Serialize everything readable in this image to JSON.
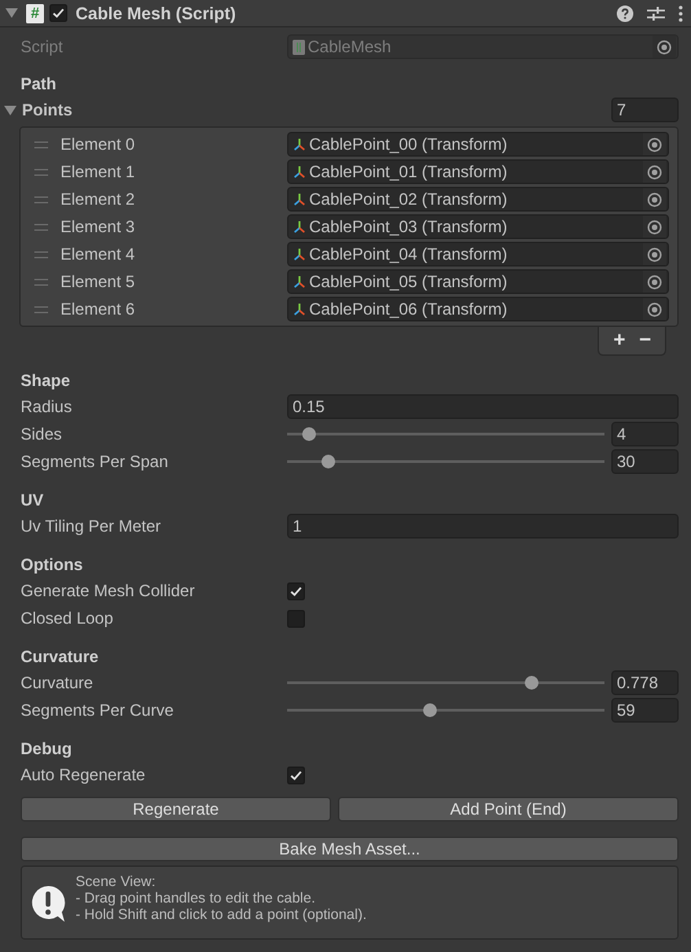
{
  "component": {
    "title": "Cable Mesh (Script)",
    "icon": "#",
    "enabled": true,
    "expanded": true
  },
  "script_field": {
    "label": "Script",
    "value": "CableMesh"
  },
  "sections": [
    {
      "header": "Path",
      "fields": [
        {
          "kind": "list",
          "label": "Points",
          "expanded": true,
          "count": "7",
          "add": "+",
          "remove": "−",
          "elements": [
            {
              "label": "Element 0",
              "value": "CablePoint_00 (Transform)"
            },
            {
              "label": "Element 1",
              "value": "CablePoint_01 (Transform)"
            },
            {
              "label": "Element 2",
              "value": "CablePoint_02 (Transform)"
            },
            {
              "label": "Element 3",
              "value": "CablePoint_03 (Transform)"
            },
            {
              "label": "Element 4",
              "value": "CablePoint_04 (Transform)"
            },
            {
              "label": "Element 5",
              "value": "CablePoint_05 (Transform)"
            },
            {
              "label": "Element 6",
              "value": "CablePoint_06 (Transform)"
            }
          ]
        }
      ]
    },
    {
      "header": "Shape",
      "fields": [
        {
          "kind": "text",
          "label": "Radius",
          "value": "0.15"
        },
        {
          "kind": "slider",
          "label": "Sides",
          "level": 0.07,
          "value": "4"
        },
        {
          "kind": "slider",
          "label": "Segments Per Span",
          "level": 0.13,
          "value": "30"
        }
      ]
    },
    {
      "header": "UV",
      "fields": [
        {
          "kind": "text",
          "label": "Uv Tiling Per Meter",
          "value": "1"
        }
      ]
    },
    {
      "header": "Options",
      "fields": [
        {
          "kind": "checkbox",
          "label": "Generate Mesh Collider",
          "checked": true
        },
        {
          "kind": "checkbox",
          "label": "Closed Loop",
          "checked": false
        }
      ]
    },
    {
      "header": "Curvature",
      "fields": [
        {
          "kind": "slider",
          "label": "Curvature",
          "level": 0.77,
          "value": "0.778"
        },
        {
          "kind": "slider",
          "label": "Segments Per Curve",
          "level": 0.45,
          "value": "59"
        }
      ]
    },
    {
      "header": "Debug",
      "fields": [
        {
          "kind": "checkbox",
          "label": "Auto Regenerate",
          "checked": true
        }
      ]
    }
  ],
  "buttons": [
    {
      "label": "Regenerate"
    },
    {
      "label": "Add Point (End)"
    }
  ],
  "bake_button": "Bake Mesh Asset...",
  "help_box": {
    "lines": [
      "Scene View:",
      "- Drag point handles to edit the cable.",
      "- Hold Shift and click to add a point (optional)."
    ]
  }
}
